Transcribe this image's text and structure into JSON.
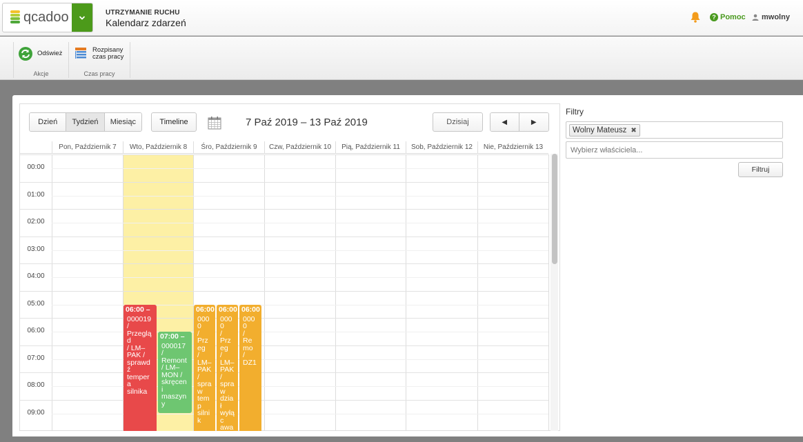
{
  "header": {
    "logo_text": "qcadoo",
    "module": "UTRZYMANIE RUCHU",
    "title": "Kalendarz zdarzeń",
    "help_label": "Pomoc",
    "username": "mwolny",
    "icons": [
      "bell-icon",
      "help-icon",
      "user-icon",
      "chevron-down-icon"
    ]
  },
  "ribbon": {
    "groups": [
      {
        "label": "Akcje",
        "buttons": [
          {
            "label": "Odśwież",
            "icon": "refresh-icon"
          }
        ]
      },
      {
        "label": "Czas pracy",
        "buttons": [
          {
            "label_line1": "Rozpisany",
            "label_line2": "czas pracy",
            "icon": "schedule-list-icon"
          }
        ]
      }
    ]
  },
  "calendar": {
    "views": [
      "Dzień",
      "Tydzień",
      "Miesiąc"
    ],
    "active_view": "Tydzień",
    "timeline_label": "Timeline",
    "range_title": "7 Paź 2019 – 13 Paź 2019",
    "today_label": "Dzisiaj",
    "prev_label": "◀",
    "next_label": "▶",
    "days": [
      "Pon, Październik 7",
      "Wto, Październik 8",
      "Śro, Październik 9",
      "Czw, Październik 10",
      "Pią, Październik 11",
      "Sob, Październik 12",
      "Nie, Październik 13"
    ],
    "hours": [
      "00:00",
      "01:00",
      "02:00",
      "03:00",
      "04:00",
      "05:00",
      "06:00",
      "07:00",
      "08:00",
      "09:00"
    ],
    "events": [
      {
        "time": "06:00 –",
        "title": "000019\n/\nPrzegląd\n/ LM–\nPAK /\nsprawdź\ntempera\nsilnika",
        "color": "#e8494a"
      },
      {
        "time": "07:00 –",
        "title": "000017\n/\nRemont\n/ LM–\nMON /\nskręceni\nmaszyny",
        "color": "#6ec671"
      },
      {
        "time": "06:00",
        "title": "0000\n/\nPrzeg\n/\nLM–\nPAK\n/\nspraw\ntemp\nsilnik",
        "color": "#f2ae2e"
      },
      {
        "time": "06:00",
        "title": "0000\n/\nPrzeg\n/\nLM–\nPAK\n/\nspraw\ndział\nwyłąc\nawar",
        "color": "#f2ae2e"
      },
      {
        "time": "06:00",
        "title": "0000\n/\nRemo\n/\nDZ1",
        "color": "#f2ae2e"
      }
    ]
  },
  "filters": {
    "title": "Filtry",
    "selected_owner": "Wolny Mateusz",
    "owner_placeholder": "Wybierz właściciela...",
    "filter_button": "Filtruj"
  },
  "colors": {
    "brand_green": "#4c9a1a",
    "today_highlight": "#fdf0a5",
    "event_red": "#e8494a",
    "event_green": "#6ec671",
    "event_orange": "#f2ae2e"
  }
}
